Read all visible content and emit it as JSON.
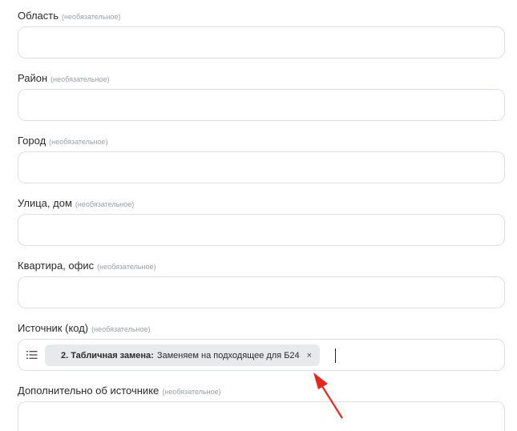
{
  "optional_hint": "(необязательное)",
  "fields": [
    {
      "label": "Область",
      "value": ""
    },
    {
      "label": "Район",
      "value": ""
    },
    {
      "label": "Город",
      "value": ""
    },
    {
      "label": "Улица, дом",
      "value": ""
    },
    {
      "label": "Квартира, офис",
      "value": ""
    },
    {
      "label": "Источник (код)",
      "value": ""
    },
    {
      "label": "Дополнительно об источнике",
      "value": ""
    }
  ],
  "source_chip": {
    "title": "2. Табличная замена:",
    "text": "Заменяем на подходящее для Б24",
    "remove": "×"
  },
  "icons": {
    "list": "list-icon",
    "remove": "close-icon",
    "annotation": "red-arrow"
  },
  "colors": {
    "arrow": "#e8261e",
    "border": "#dcdfe3",
    "chip_bg": "#e7e9ec"
  }
}
